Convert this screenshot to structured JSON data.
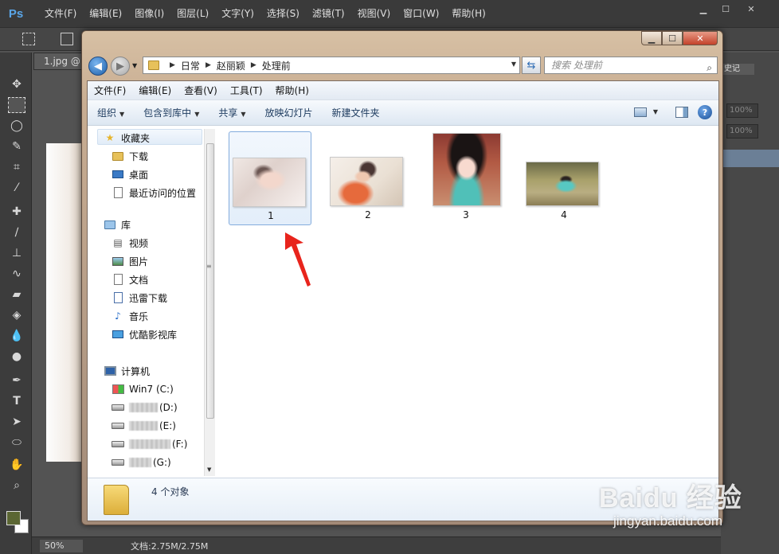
{
  "ps": {
    "logo": "Ps",
    "menu": [
      "文件(F)",
      "编辑(E)",
      "图像(I)",
      "图层(L)",
      "文字(Y)",
      "选择(S)",
      "滤镜(T)",
      "视图(V)",
      "窗口(W)",
      "帮助(H)"
    ],
    "tab": "1.jpg @",
    "right_panel_tab": "史记",
    "opacity_1": "100%",
    "opacity_2": "100%",
    "zoom": "50%",
    "doc_info": "文档:2.75M/2.75M"
  },
  "explorer": {
    "breadcrumb": [
      "日常",
      "赵丽颖",
      "处理前"
    ],
    "search_placeholder": "搜索 处理前",
    "menu": [
      "文件(F)",
      "编辑(E)",
      "查看(V)",
      "工具(T)",
      "帮助(H)"
    ],
    "commands": [
      {
        "label": "组织",
        "dropdown": true
      },
      {
        "label": "包含到库中",
        "dropdown": true
      },
      {
        "label": "共享",
        "dropdown": true
      },
      {
        "label": "放映幻灯片",
        "dropdown": false
      },
      {
        "label": "新建文件夹",
        "dropdown": false
      }
    ],
    "nav": {
      "favorites": "收藏夹",
      "downloads": "下载",
      "desktop": "桌面",
      "recent": "最近访问的位置",
      "libraries": "库",
      "videos": "视频",
      "pictures": "图片",
      "documents": "文档",
      "xunlei": "迅雷下载",
      "music": "音乐",
      "youku": "优酷影视库",
      "computer": "计算机",
      "drive_c": "Win7 (C:)",
      "drive_d": "(D:)",
      "drive_e": "(E:)",
      "drive_f": "(F:)",
      "drive_g": "(G:)"
    },
    "files": [
      {
        "name": "1",
        "selected": true
      },
      {
        "name": "2",
        "selected": false
      },
      {
        "name": "3",
        "selected": false
      },
      {
        "name": "4",
        "selected": false
      }
    ],
    "status": "4 个对象"
  },
  "watermark": {
    "logo": "Baidu 经验",
    "url": "jingyan.baidu.com"
  },
  "colors": {
    "arrow": "#e8241c",
    "foreground": "#5b6633",
    "background": "#ffffff"
  }
}
